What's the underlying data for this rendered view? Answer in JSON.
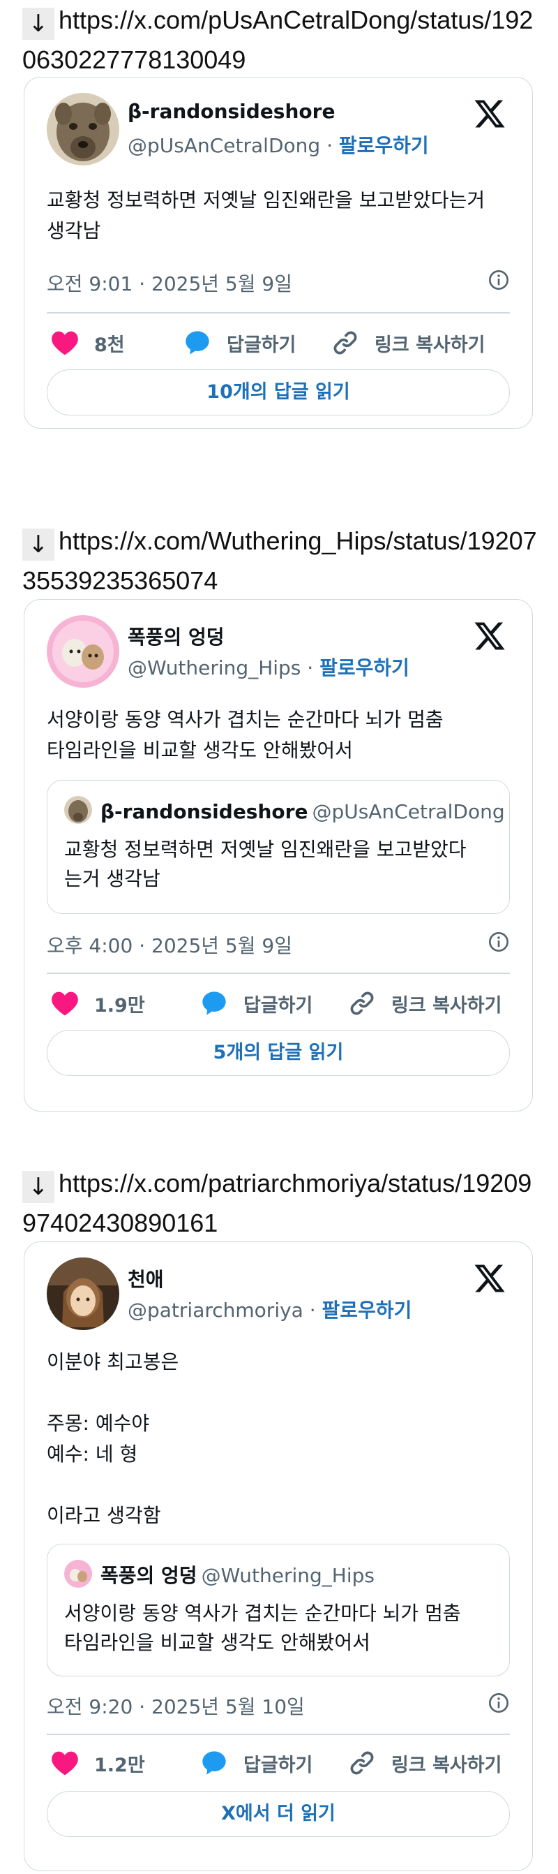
{
  "posts": [
    {
      "url": "https://x.com/pUsAnCetralDong/status/1920630227778130049",
      "author": {
        "name": "β-randonsideshore",
        "handle": "@pUsAnCetralDong"
      },
      "follow_label": "팔로우하기",
      "text": "교황청 정보력하면 저옛날 임진왜란을 보고받았다는거\n생각남",
      "timestamp": "오전 9:01 · 2025년 5월 9일",
      "likes": "8천",
      "reply_label": "답글하기",
      "copy_label": "링크 복사하기",
      "read_replies": "10개의 답글 읽기"
    },
    {
      "url": "https://x.com/Wuthering_Hips/status/1920735539235365074",
      "author": {
        "name": "폭풍의 엉덩",
        "handle": "@Wuthering_Hips"
      },
      "follow_label": "팔로우하기",
      "text": "서양이랑 동양 역사가 겹치는 순간마다 뇌가 멈춤\n타임라인을 비교할 생각도 안해봤어서",
      "quote": {
        "name": "β-randonsideshore",
        "handle": "@pUsAnCetralDong",
        "text": "교황청 정보력하면 저옛날 임진왜란을 보고받았다\n는거 생각남"
      },
      "timestamp": "오후 4:00 · 2025년 5월 9일",
      "likes": "1.9만",
      "reply_label": "답글하기",
      "copy_label": "링크 복사하기",
      "read_replies": "5개의 답글 읽기"
    },
    {
      "url": "https://x.com/patriarchmoriya/status/1920997402430890161",
      "author": {
        "name": "천애",
        "handle": "@patriarchmoriya"
      },
      "follow_label": "팔로우하기",
      "text": "이분야 최고봉은\n\n주몽: 예수야\n예수: 네 형\n\n이라고 생각함",
      "quote": {
        "name": "폭풍의 엉덩",
        "handle": "@Wuthering_Hips",
        "text": "서양이랑 동양 역사가 겹치는 순간마다 뇌가 멈춤\n타임라인을 비교할 생각도 안해봤어서"
      },
      "timestamp": "오전 9:20 · 2025년 5월 10일",
      "likes": "1.2만",
      "reply_label": "답글하기",
      "copy_label": "링크 복사하기",
      "read_replies": "X에서 더 읽기"
    }
  ],
  "arrow": "↓",
  "colors": {
    "like": "#f91880",
    "reply": "#1d9bf0",
    "link": "#1d70b8",
    "muted": "#536471",
    "border": "#cfd9de"
  },
  "icons": [
    "down-arrow-icon",
    "x-logo-icon",
    "info-icon",
    "heart-icon",
    "reply-bubble-icon",
    "link-icon"
  ]
}
